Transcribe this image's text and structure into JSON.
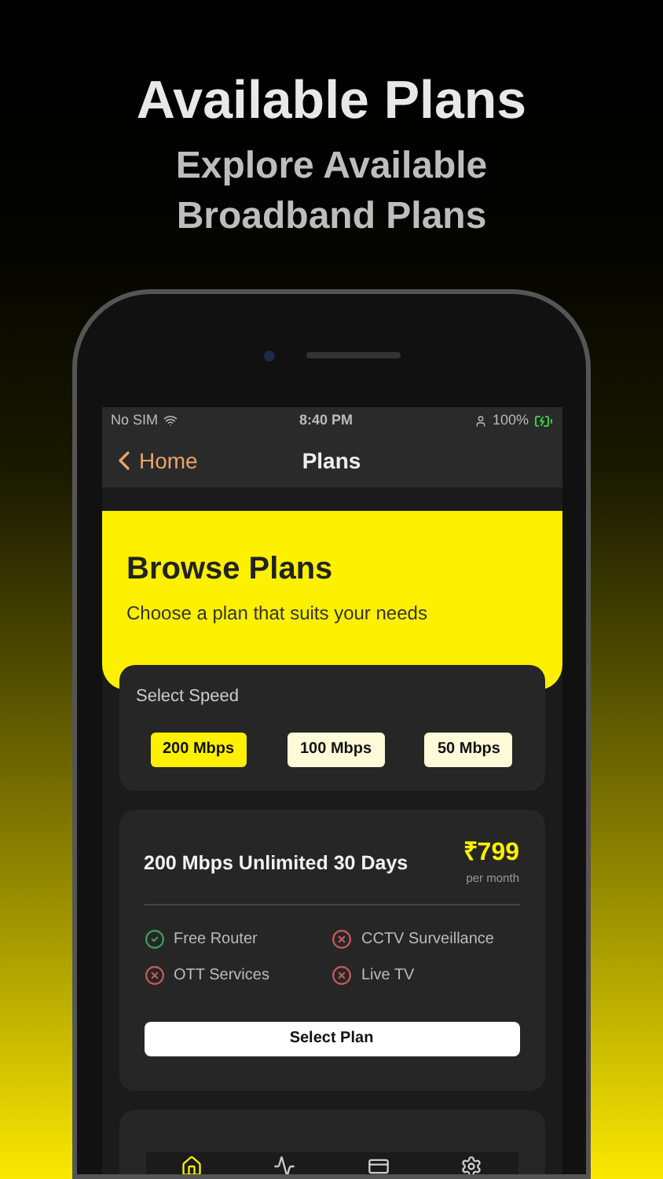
{
  "headline": {
    "title": "Available Plans",
    "subtitle": "Explore Available Broadband Plans"
  },
  "status_bar": {
    "carrier": "No SIM",
    "time": "8:40 PM",
    "battery": "100%"
  },
  "nav": {
    "back": "Home",
    "title": "Plans"
  },
  "header": {
    "title": "Browse Plans",
    "subtitle": "Choose a plan that suits your needs"
  },
  "speed": {
    "label": "Select Speed",
    "options": [
      {
        "label": "200 Mbps",
        "selected": true
      },
      {
        "label": "100 Mbps",
        "selected": false
      },
      {
        "label": "50 Mbps",
        "selected": false
      }
    ]
  },
  "plan": {
    "name": "200 Mbps Unlimited 30 Days",
    "price": "₹799",
    "period": "per month",
    "button": "Select Plan",
    "features": [
      {
        "label": "Free Router",
        "included": true
      },
      {
        "label": "CCTV Surveillance",
        "included": false
      },
      {
        "label": "OTT Services",
        "included": false
      },
      {
        "label": "Live TV",
        "included": false
      }
    ]
  },
  "tabs": [
    {
      "kind": "home",
      "selected": true
    },
    {
      "kind": "activity",
      "selected": false
    },
    {
      "kind": "card",
      "selected": false
    },
    {
      "kind": "settings",
      "selected": false
    }
  ]
}
